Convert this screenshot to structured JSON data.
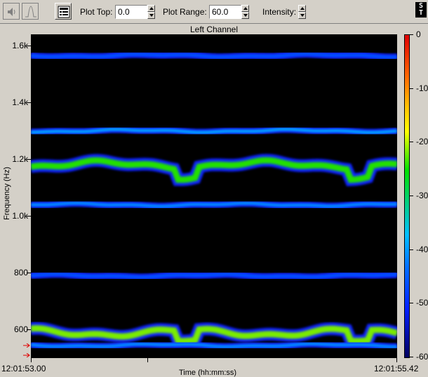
{
  "toolbar": {
    "plot_top_label": "Plot Top:",
    "plot_top_value": "0.0",
    "plot_range_label": "Plot Range:",
    "plot_range_value": "60.0",
    "intensity_label": "Intensity:",
    "logo_text": "S T"
  },
  "chart_data": {
    "type": "heatmap",
    "title": "Left Channel",
    "y_ticks": [
      "1.6k",
      "1.4k",
      "1.2k",
      "1.0k",
      "800",
      "600"
    ],
    "y_tick_values": [
      1600,
      1400,
      1200,
      1000,
      800,
      600
    ],
    "ylim": [
      500,
      1640
    ],
    "ylabel": "Frequency (Hz)",
    "x_ticks": [
      "12:01:53.00",
      "12:01:55.42"
    ],
    "xlabel": "Time (hh:mm:ss)",
    "colorbar_ticks": [
      "0",
      "-10",
      "-20",
      "-30",
      "-40",
      "-50",
      "-60"
    ],
    "colorbar_range": [
      -60,
      0
    ],
    "bands": [
      {
        "freq_hz": 1565,
        "level_db": -45
      },
      {
        "freq_hz": 1300,
        "level_db": -38
      },
      {
        "freq_hz": 1180,
        "level_db": -22
      },
      {
        "freq_hz": 1040,
        "level_db": -40
      },
      {
        "freq_hz": 790,
        "level_db": -45
      },
      {
        "freq_hz": 590,
        "level_db": -20
      },
      {
        "freq_hz": 545,
        "level_db": -40
      }
    ],
    "markers_hz": [
      545,
      510
    ]
  },
  "colors": {
    "background": "#000000",
    "band_low": "#1020ff",
    "band_mid": "#00c0ff",
    "band_high": "#20e000"
  }
}
